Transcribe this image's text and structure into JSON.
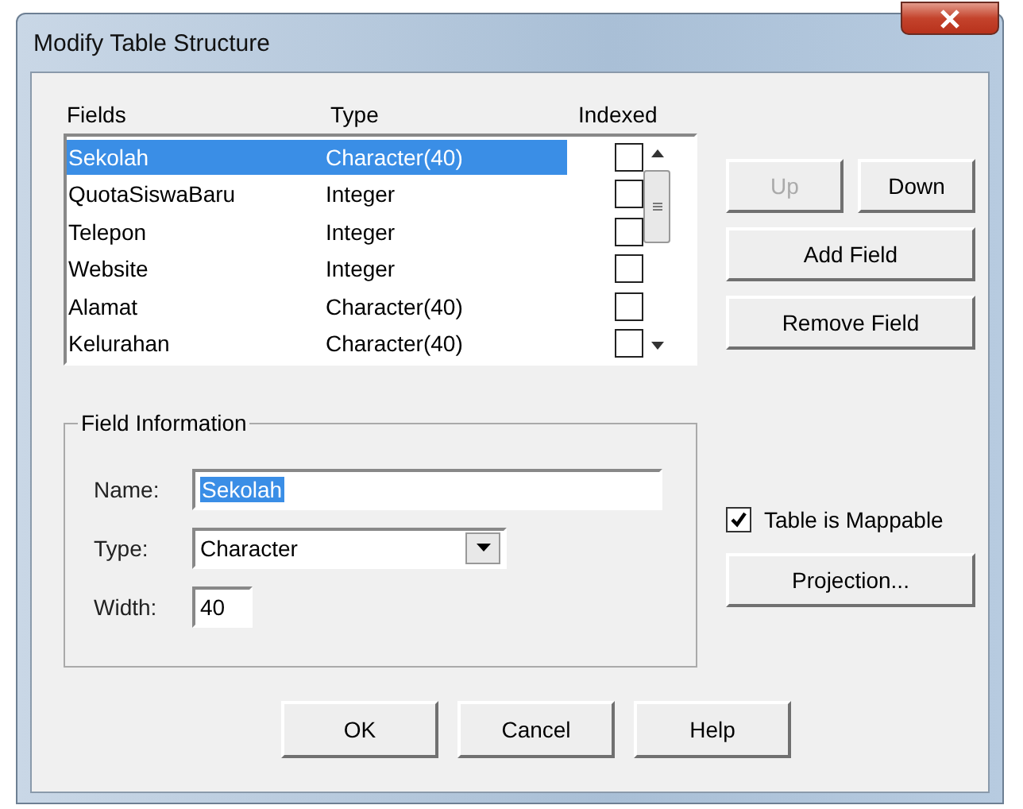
{
  "window": {
    "title": "Modify Table Structure"
  },
  "fields_list": {
    "columns": [
      "Fields",
      "Type",
      "Indexed"
    ],
    "rows": [
      {
        "name": "Sekolah",
        "type": "Character(40)",
        "indexed": false,
        "selected": true
      },
      {
        "name": "QuotaSiswaBaru",
        "type": "Integer",
        "indexed": false,
        "selected": false
      },
      {
        "name": "Telepon",
        "type": "Integer",
        "indexed": false,
        "selected": false
      },
      {
        "name": "Website",
        "type": "Integer",
        "indexed": false,
        "selected": false
      },
      {
        "name": "Alamat",
        "type": "Character(40)",
        "indexed": false,
        "selected": false
      },
      {
        "name": "Kelurahan",
        "type": "Character(40)",
        "indexed": false,
        "selected": false
      }
    ]
  },
  "move_buttons": [
    {
      "label": "Up",
      "disabled": true
    },
    {
      "label": "Down",
      "disabled": false
    }
  ],
  "field_buttons": [
    {
      "label": "Add Field",
      "disabled": false
    },
    {
      "label": "Remove Field",
      "disabled": false
    }
  ],
  "field_information": {
    "title": "Field Information",
    "name_label": "Name:",
    "name_value": "Sekolah",
    "type_label": "Type:",
    "type_value": "Character",
    "width_label": "Width:",
    "width_value": "40"
  },
  "mappable": {
    "label": "Table is Mappable",
    "checked": true
  },
  "projection_button": "Projection...",
  "footer_buttons": [
    "OK",
    "Cancel",
    "Help"
  ]
}
